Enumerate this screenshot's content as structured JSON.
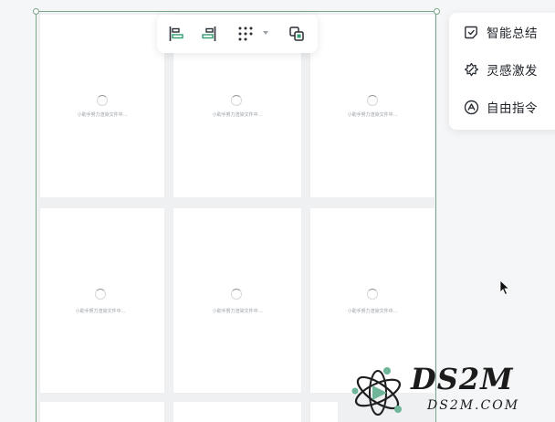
{
  "toolbar": {
    "tools": [
      {
        "icon": "align-left-icon"
      },
      {
        "icon": "align-right-icon"
      },
      {
        "icon": "grid-layout-icon",
        "has_dropdown": true
      },
      {
        "icon": "group-icon"
      }
    ]
  },
  "ai_menu": {
    "items": [
      {
        "label": "智能总结",
        "icon": "summary-note-icon"
      },
      {
        "label": "灵感激发",
        "icon": "inspiration-burst-icon"
      },
      {
        "label": "自由指令",
        "icon": "command-a-icon"
      }
    ]
  },
  "pages": [
    {
      "loading_text": "小助手努力渲染文件中..."
    },
    {
      "loading_text": "小助手努力渲染文件中..."
    },
    {
      "loading_text": "小助手努力渲染文件中..."
    },
    {
      "loading_text": "小助手努力渲染文件中..."
    },
    {
      "loading_text": "小助手努力渲染文件中..."
    },
    {
      "loading_text": "小助手努力渲染文件中..."
    }
  ],
  "watermark": {
    "title": "DS2M",
    "subtitle": "DS2M.COM"
  },
  "colors": {
    "selection": "#7aa58c",
    "icon_dark": "#2b2f36",
    "icon_green": "#2f9e6e",
    "canvas": "#eef0f2"
  }
}
